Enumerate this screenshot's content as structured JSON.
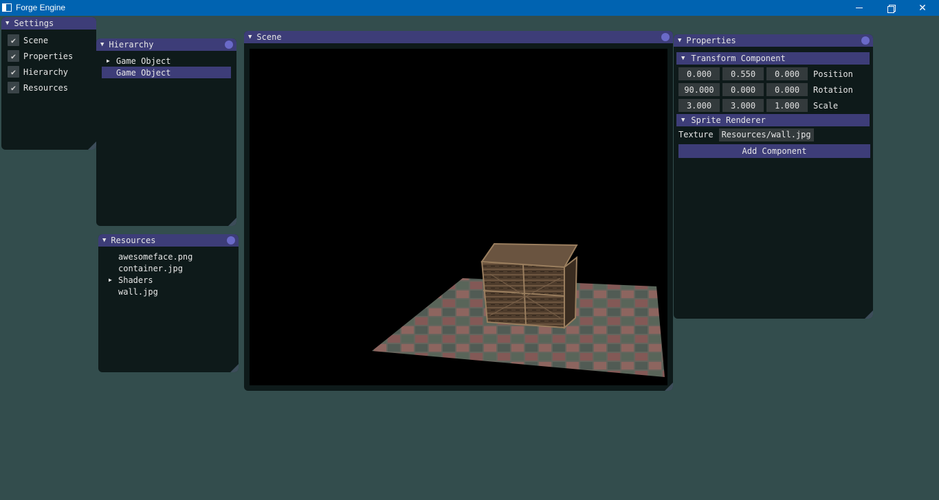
{
  "window": {
    "title": "Forge Engine"
  },
  "settings": {
    "title": "Settings",
    "items": [
      {
        "label": "Scene",
        "checked": true
      },
      {
        "label": "Properties",
        "checked": true
      },
      {
        "label": "Hierarchy",
        "checked": true
      },
      {
        "label": "Resources",
        "checked": true
      }
    ]
  },
  "hierarchy": {
    "title": "Hierarchy",
    "items": [
      {
        "label": "Game Object",
        "expandable": true,
        "selected": false
      },
      {
        "label": "Game Object",
        "expandable": false,
        "selected": true
      }
    ]
  },
  "resources": {
    "title": "Resources",
    "items": [
      {
        "label": "awesomeface.png",
        "expandable": false
      },
      {
        "label": "container.jpg",
        "expandable": false
      },
      {
        "label": "Shaders",
        "expandable": true
      },
      {
        "label": "wall.jpg",
        "expandable": false
      }
    ]
  },
  "scene": {
    "title": "Scene"
  },
  "properties": {
    "title": "Properties",
    "transform": {
      "title": "Transform Component",
      "position": {
        "label": "Position",
        "x": "0.000",
        "y": "0.550",
        "z": "0.000"
      },
      "rotation": {
        "label": "Rotation",
        "x": "90.000",
        "y": "0.000",
        "z": "0.000"
      },
      "scale": {
        "label": "Scale",
        "x": "3.000",
        "y": "3.000",
        "z": "1.000"
      }
    },
    "sprite_renderer": {
      "title": "Sprite Renderer",
      "texture_label": "Texture",
      "texture_value": "Resources/wall.jpg"
    },
    "add_component_label": "Add Component"
  },
  "colors": {
    "background": "#334d4d",
    "panel": "#0e1a1a",
    "header": "#3d3d78",
    "titlebar": "#0063b1"
  }
}
